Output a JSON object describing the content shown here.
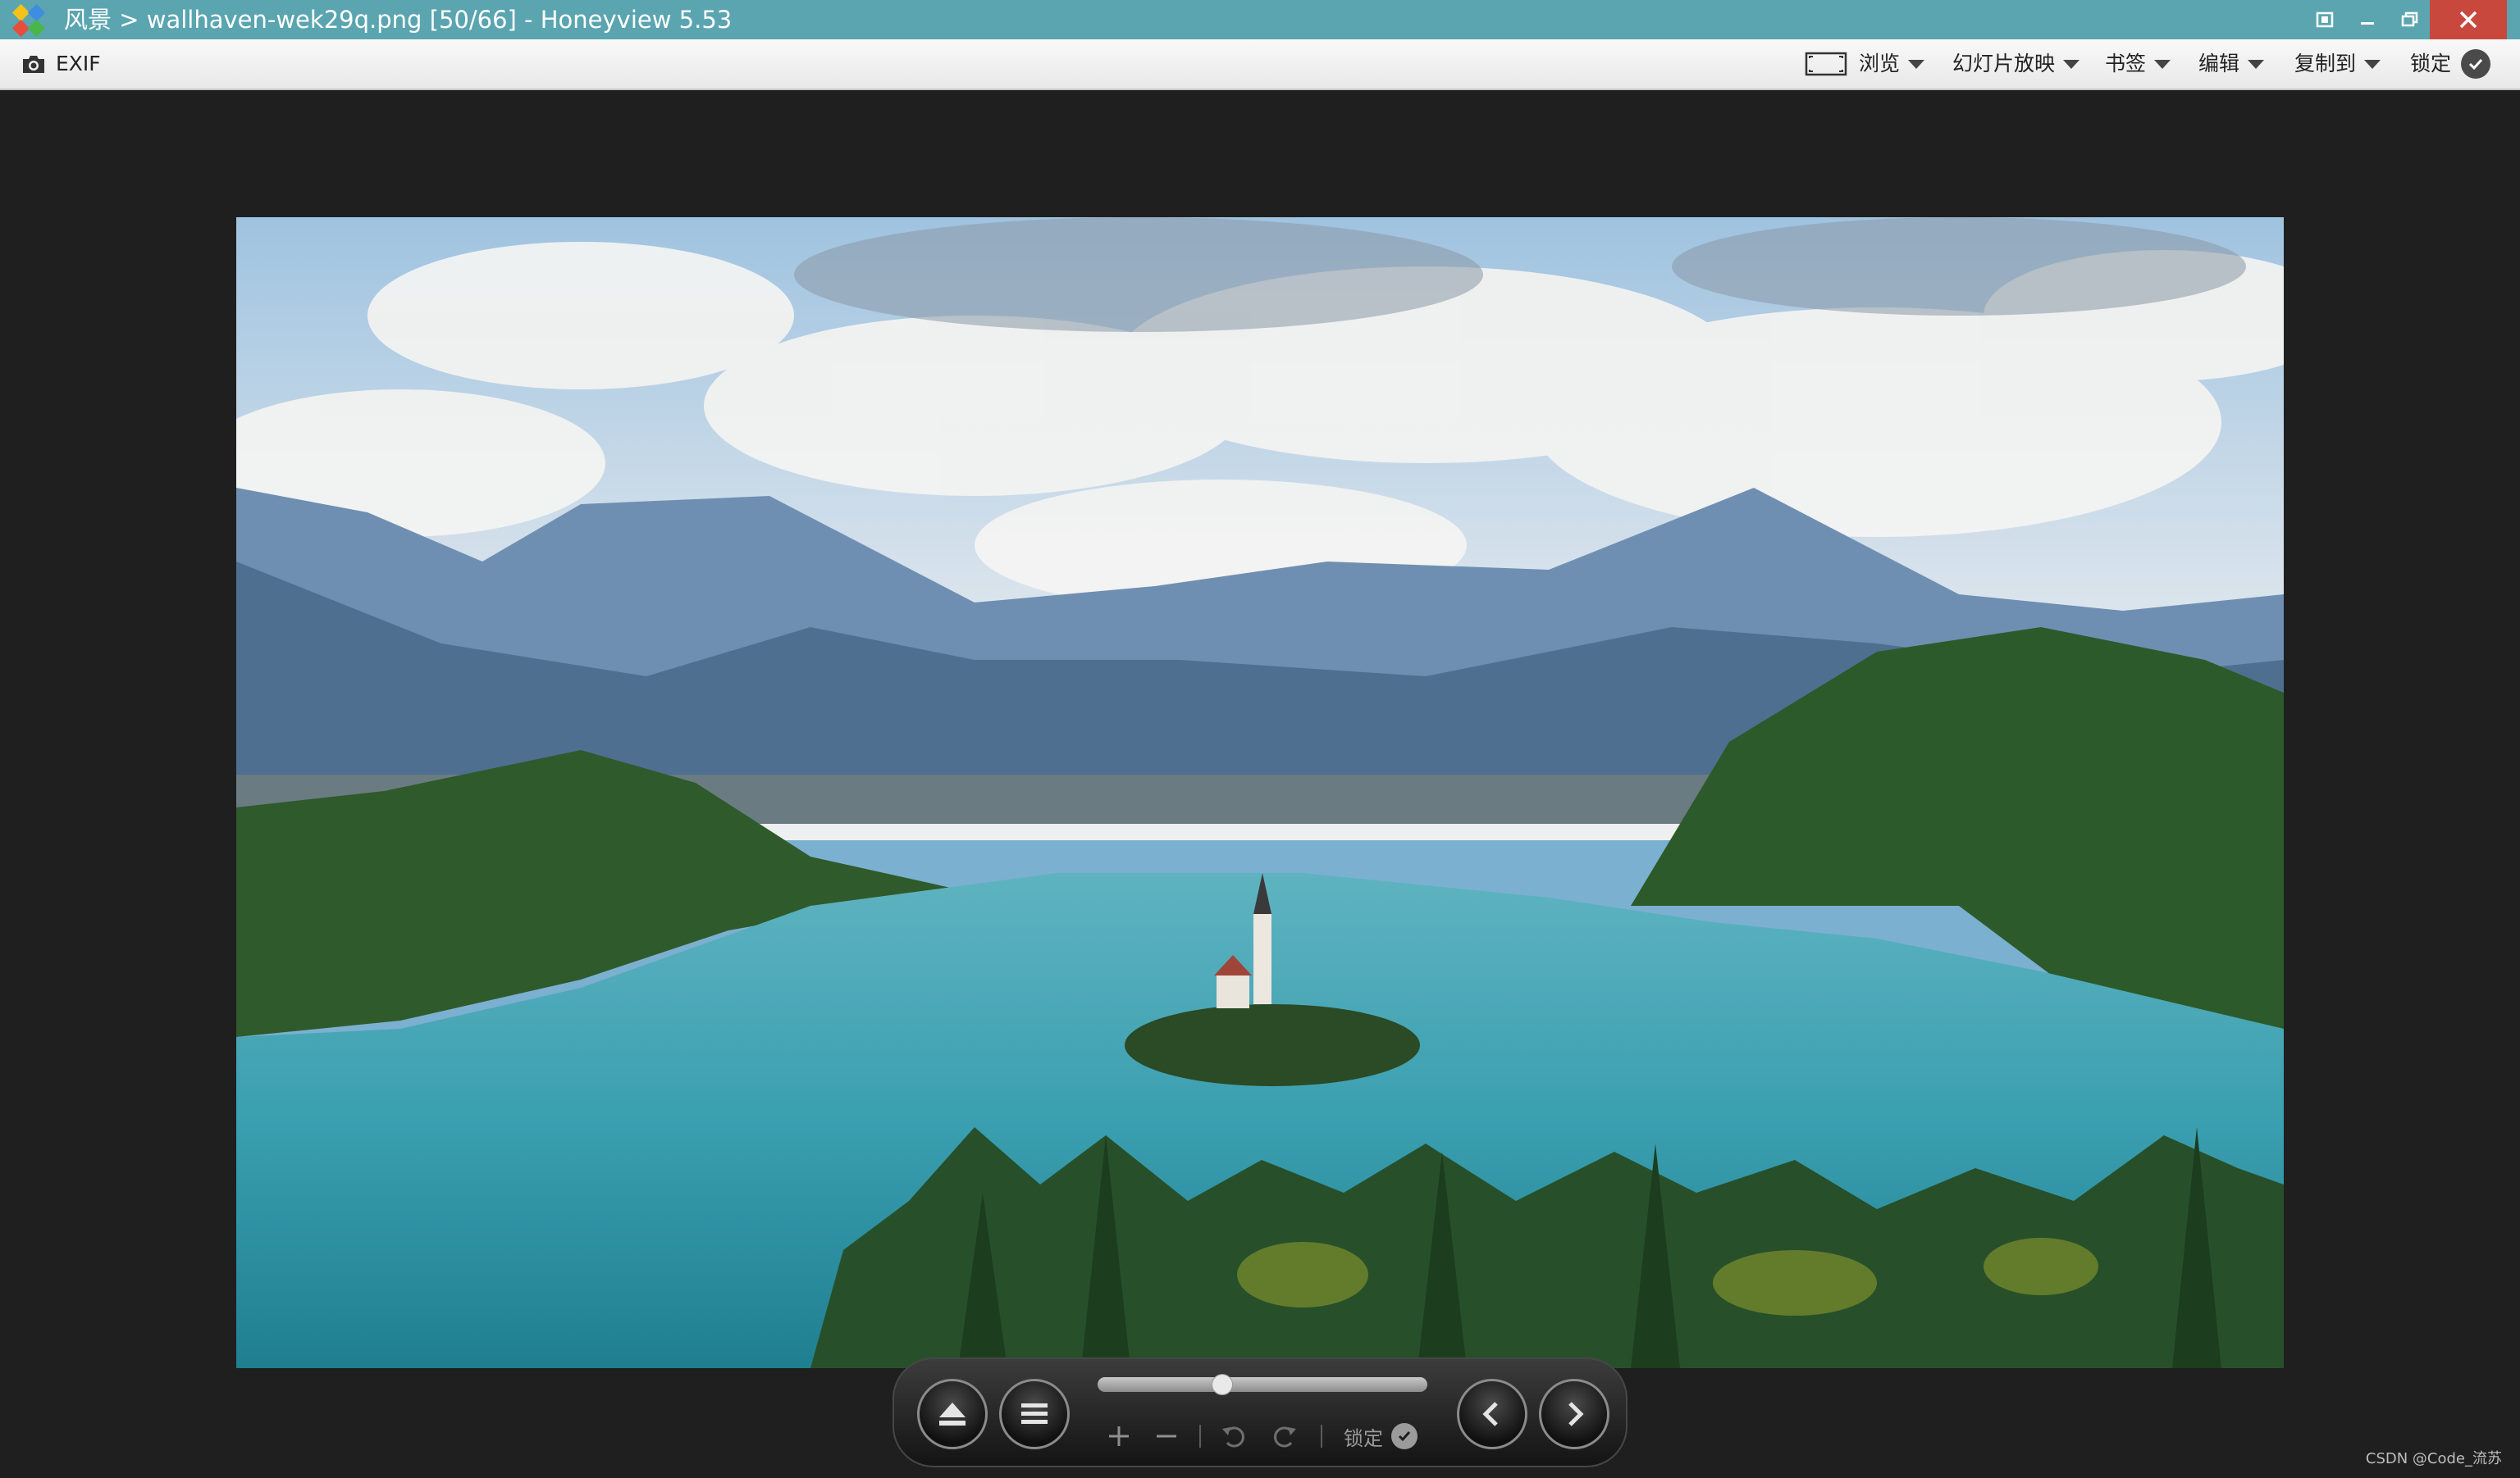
{
  "window": {
    "title": "风景 > wallhaven-wek29q.png [50/66] - Honeyview 5.53",
    "close_color": "#c9483e",
    "titlebar_color": "#5aa5b0"
  },
  "toolbar": {
    "exif_label": "EXIF",
    "browse_label": "浏览",
    "slideshow_label": "幻灯片放映",
    "bookmark_label": "书签",
    "edit_label": "编辑",
    "copyto_label": "复制到",
    "lock_label": "锁定"
  },
  "image": {
    "filename": "wallhaven-wek29q.png",
    "folder": "风景",
    "index_text": "[50/66]"
  },
  "controls": {
    "lock_label": "锁定",
    "slider_fraction": 0.37
  },
  "icons": [
    "app-logo",
    "camera-icon",
    "fit-frame-icon",
    "chevron-down-icon",
    "check-icon",
    "eject-icon",
    "menu-icon",
    "zoom-in-icon",
    "zoom-out-icon",
    "rotate-left-icon",
    "rotate-right-icon",
    "prev-icon",
    "next-icon"
  ],
  "watermark": "CSDN @Code_流苏"
}
